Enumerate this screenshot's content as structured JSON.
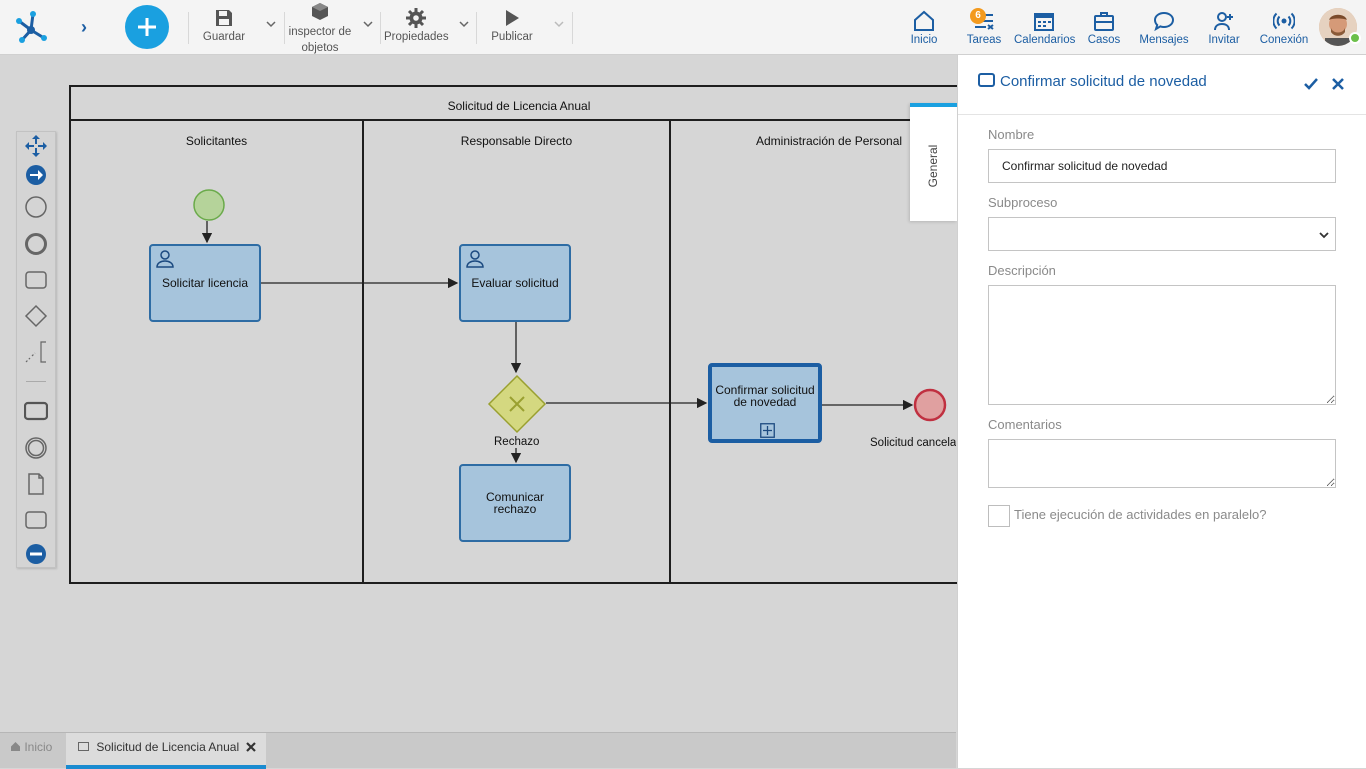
{
  "toolbar": {
    "save": "Guardar",
    "inspector": [
      "inspector de",
      "objetos"
    ],
    "properties": "Propiedades",
    "publish": "Publicar"
  },
  "nav": {
    "home": "Inicio",
    "tasks": "Tareas",
    "tasks_badge": "6",
    "calendars": "Calendarios",
    "cases": "Casos",
    "messages": "Mensajes",
    "invite": "Invitar",
    "connection": "Conexión"
  },
  "diagram": {
    "pool_title": "Solicitud de Licencia Anual",
    "lanes": [
      "Solicitantes",
      "Responsable Directo",
      "Administración de Personal"
    ],
    "tasks": {
      "request": "Solicitar licencia",
      "evaluate": "Evaluar solicitud",
      "confirm": [
        "Confirmar solicitud",
        "de novedad"
      ],
      "reject": [
        "Comunicar",
        "rechazo"
      ]
    },
    "gateway_label": "Rechazo",
    "end_label": "Solicitud cancela"
  },
  "tabs": {
    "home": "Inicio",
    "process": "Solicitud de Licencia Anual"
  },
  "side_tab": "General",
  "panel": {
    "title": "Confirmar solicitud de novedad",
    "name_label": "Nombre",
    "name_value": "Confirmar solicitud de novedad",
    "subprocess_label": "Subproceso",
    "subprocess_value": "",
    "description_label": "Descripción",
    "comments_label": "Comentarios",
    "parallel_label": "Tiene ejecución de actividades en paralelo?"
  },
  "colors": {
    "accent": "#1c5ea3",
    "primary_button": "#1aa0e0",
    "badge": "#f39a1e",
    "task_fill": "#a6c4dc",
    "task_border": "#2e6ca4",
    "gateway": "#d4d880",
    "end_event": "#e0a0a0",
    "start_event": "#b5d39a"
  }
}
